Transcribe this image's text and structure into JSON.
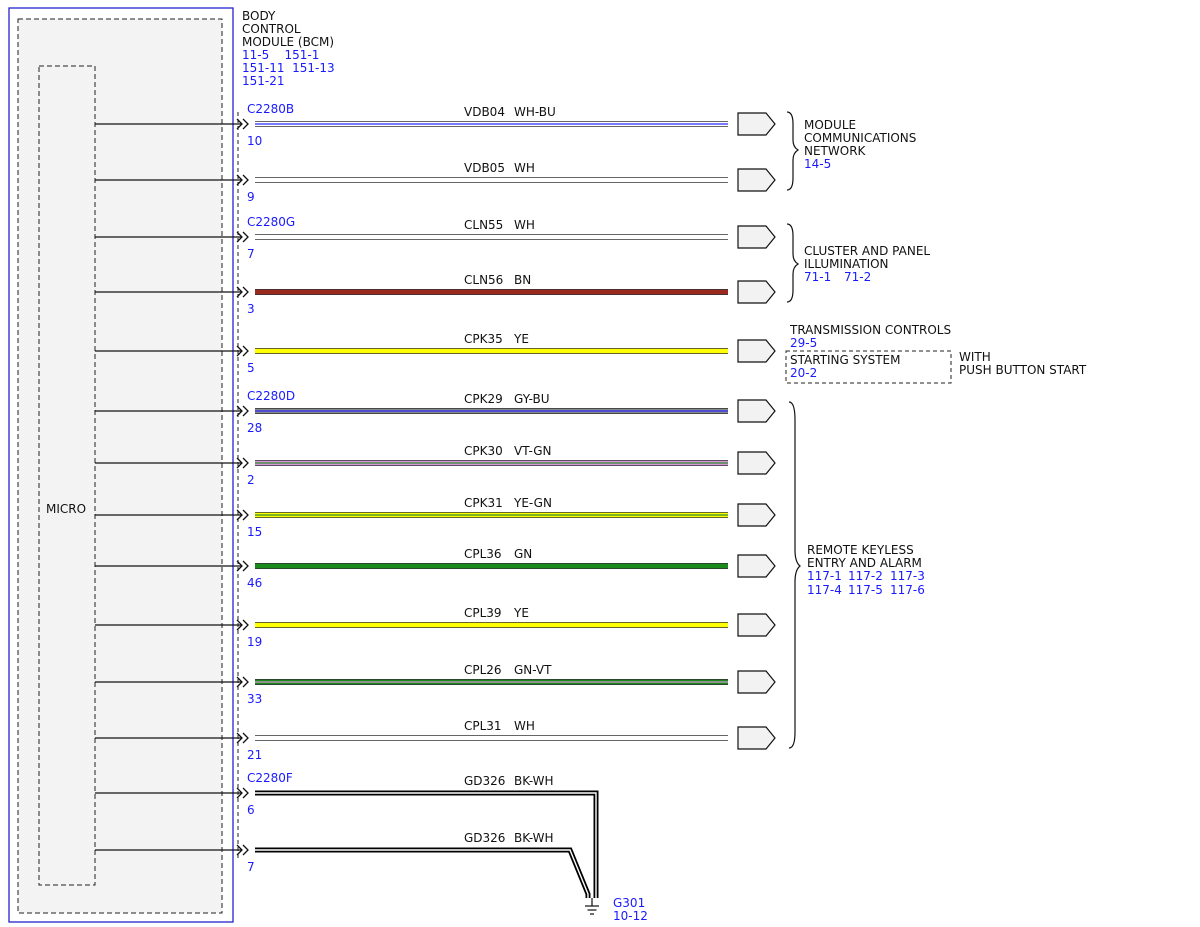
{
  "module": {
    "title_lines": [
      "BODY",
      "CONTROL",
      "MODULE (BCM)"
    ],
    "ref_lines": [
      "11-5    151-1",
      "151-11  151-13",
      "151-21"
    ],
    "micro_label": "MICRO",
    "border_color": "#2222cc"
  },
  "wires": [
    {
      "connector": "C2280B",
      "pin": "10",
      "circuit": "VDB04",
      "color_code": "WH-BU",
      "colors": [
        "#ffffff",
        "#2a2aff"
      ],
      "end": "arrow"
    },
    {
      "connector": "",
      "pin": "9",
      "circuit": "VDB05",
      "color_code": "WH",
      "colors": [
        "#ffffff"
      ],
      "end": "arrow"
    },
    {
      "connector": "C2280G",
      "pin": "7",
      "circuit": "CLN55",
      "color_code": "WH",
      "colors": [
        "#ffffff"
      ],
      "end": "arrow"
    },
    {
      "connector": "",
      "pin": "3",
      "circuit": "CLN56",
      "color_code": "BN",
      "colors": [
        "#9b2a1e"
      ],
      "end": "arrow"
    },
    {
      "connector": "",
      "pin": "5",
      "circuit": "CPK35",
      "color_code": "YE",
      "colors": [
        "#ffff00"
      ],
      "end": "arrow"
    },
    {
      "connector": "C2280D",
      "pin": "28",
      "circuit": "CPK29",
      "color_code": "GY-BU",
      "colors": [
        "#8a8a8a",
        "#2a2aff"
      ],
      "end": "arrow"
    },
    {
      "connector": "",
      "pin": "2",
      "circuit": "CPK30",
      "color_code": "VT-GN",
      "colors": [
        "#d596d8",
        "#2e8b2e"
      ],
      "end": "arrow"
    },
    {
      "connector": "",
      "pin": "15",
      "circuit": "CPK31",
      "color_code": "YE-GN",
      "colors": [
        "#ffff00",
        "#2e8b2e"
      ],
      "end": "arrow"
    },
    {
      "connector": "",
      "pin": "46",
      "circuit": "CPL36",
      "color_code": "GN",
      "colors": [
        "#1a8a1a"
      ],
      "end": "arrow"
    },
    {
      "connector": "",
      "pin": "19",
      "circuit": "CPL39",
      "color_code": "YE",
      "colors": [
        "#ffff00"
      ],
      "end": "arrow"
    },
    {
      "connector": "",
      "pin": "33",
      "circuit": "CPL26",
      "color_code": "GN-VT",
      "colors": [
        "#1a8a1a",
        "#d596d8"
      ],
      "end": "arrow"
    },
    {
      "connector": "",
      "pin": "21",
      "circuit": "CPL31",
      "color_code": "WH",
      "colors": [
        "#ffffff"
      ],
      "end": "arrow"
    },
    {
      "connector": "C2280F",
      "pin": "6",
      "circuit": "GD326",
      "color_code": "BK-WH",
      "colors": [
        "#000000",
        "#ffffff"
      ],
      "end": "ground"
    },
    {
      "connector": "",
      "pin": "7",
      "circuit": "GD326",
      "color_code": "BK-WH",
      "colors": [
        "#000000",
        "#ffffff"
      ],
      "end": "ground"
    }
  ],
  "destinations": [
    {
      "lines": [
        "MODULE",
        "COMMUNICATIONS",
        "NETWORK"
      ],
      "refs": [
        "14-5"
      ]
    },
    {
      "lines": [
        "CLUSTER AND PANEL",
        "ILLUMINATION"
      ],
      "refs": [
        "71-1",
        "71-2"
      ]
    },
    {
      "lines": [
        "TRANSMISSION CONTROLS"
      ],
      "refs": [
        "29-5"
      ]
    },
    {
      "lines": [
        "STARTING SYSTEM"
      ],
      "refs": [
        "20-2"
      ],
      "note": [
        "WITH",
        "PUSH BUTTON START"
      ]
    },
    {
      "lines": [
        "REMOTE KEYLESS",
        "ENTRY AND ALARM"
      ],
      "refs": [
        "117-1",
        "117-2",
        "117-3",
        "117-4",
        "117-5",
        "117-6"
      ]
    }
  ],
  "ground": {
    "name": "G301",
    "ref": "10-12"
  }
}
